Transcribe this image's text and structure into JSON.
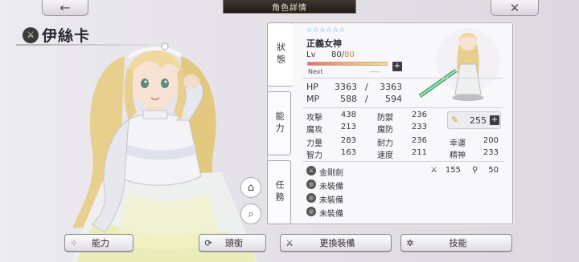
{
  "header": {
    "title": "角色詳情",
    "back_icon": "←",
    "close_icon": "✕"
  },
  "character": {
    "name": "伊絲卡"
  },
  "tabs": [
    {
      "label": "狀態"
    },
    {
      "label": "能力"
    },
    {
      "label": "任務"
    }
  ],
  "status": {
    "stars": "☆☆☆☆☆☆",
    "title": "正義女神",
    "lv_label": "Lv",
    "lv_current": "80",
    "lv_sep": "/",
    "lv_max": "80",
    "exp_fraction": 1.0,
    "next_label": "Next",
    "next_value": "----",
    "hp_label": "HP",
    "hp_cur": "3363",
    "hp_sep": "/",
    "hp_max": "3363",
    "mp_label": "MP",
    "mp_cur": "588",
    "mp_sep": "/",
    "mp_max": "594"
  },
  "abilities": {
    "rows": [
      {
        "l1": "攻擊",
        "v1": "438",
        "l2": "防禦",
        "v2": "236"
      },
      {
        "l1": "魔攻",
        "v1": "213",
        "l2": "魔防",
        "v2": "233"
      },
      {
        "l1": "力量",
        "v1": "283",
        "l2": "耐力",
        "v2": "236",
        "l3": "幸運",
        "v3": "200"
      },
      {
        "l1": "智力",
        "v1": "163",
        "l2": "速度",
        "v2": "211",
        "l3": "精神",
        "v3": "233"
      }
    ],
    "feather_value": "255"
  },
  "equipment": {
    "items": [
      {
        "label": "金剛劍",
        "icon": "sword-icon"
      },
      {
        "label": "未裝備",
        "icon": "empty-slot-icon"
      },
      {
        "label": "未裝備",
        "icon": "empty-slot-icon"
      },
      {
        "label": "未裝備",
        "icon": "empty-slot-icon"
      }
    ],
    "weapon_atk": "155",
    "weapon_sub": "50"
  },
  "buttons": {
    "ability": "能力",
    "title": "頭銜",
    "change_equip": "更換裝備",
    "skill": "技能"
  },
  "colors": {
    "accent": "#37b6d6",
    "dark": "#3f3a44",
    "gold": "#c89030"
  }
}
